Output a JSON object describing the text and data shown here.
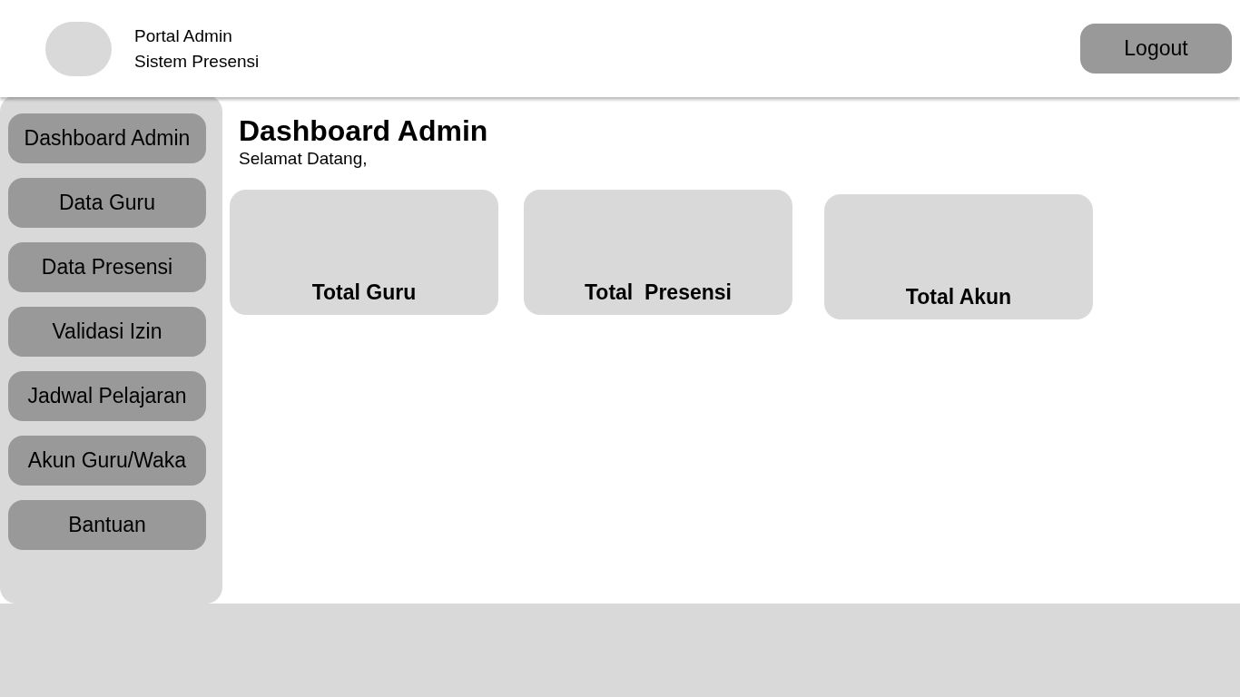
{
  "header": {
    "title": "Portal Admin",
    "subtitle": "Sistem Presensi",
    "logout": "Logout"
  },
  "sidebar": {
    "items": [
      {
        "label": "Dashboard Admin"
      },
      {
        "label": "Data Guru"
      },
      {
        "label": "Data Presensi"
      },
      {
        "label": "Validasi Izin"
      },
      {
        "label": "Jadwal Pelajaran"
      },
      {
        "label": "Akun Guru/Waka"
      },
      {
        "label": "Bantuan"
      }
    ]
  },
  "main": {
    "heading": "Dashboard Admin",
    "greeting": "Selamat Datang,",
    "cards": [
      {
        "label": "Total Guru"
      },
      {
        "label": "Total  Presensi"
      },
      {
        "label": "Total Akun"
      }
    ]
  }
}
